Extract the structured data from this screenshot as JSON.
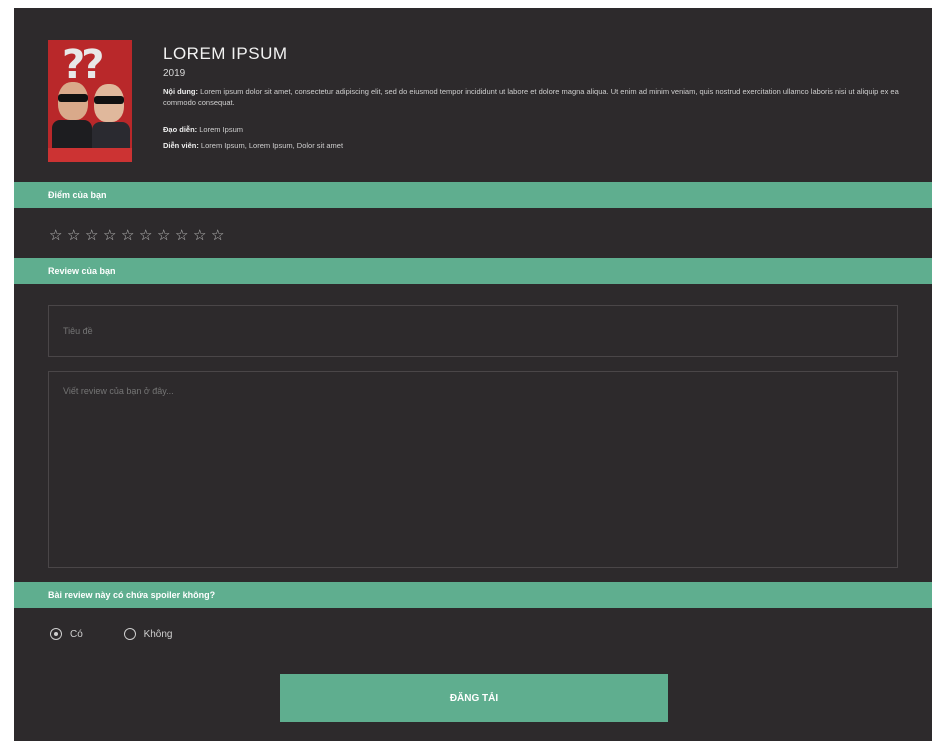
{
  "movie": {
    "title": "LOREM IPSUM",
    "year": "2019",
    "content_label": "Nội dung:",
    "content_text": " Lorem ipsum dolor sit amet, consectetur adipiscing elit, sed do eiusmod tempor incididunt ut labore et dolore magna aliqua. Ut enim ad minim veniam, quis nostrud exercitation ullamco laboris nisi ut aliquip ex ea commodo consequat.",
    "director_label": "Đạo diễn:",
    "director_value": " Lorem Ipsum",
    "cast_label": "Diễn viên:",
    "cast_value": " Lorem Ipsum, Lorem Ipsum, Dolor sit amet",
    "poster_text": "??"
  },
  "score_section": {
    "label": "Điểm của bạn",
    "stars": [
      "☆",
      "☆",
      "☆",
      "☆",
      "☆",
      "☆",
      "☆",
      "☆",
      "☆",
      "☆"
    ],
    "star_count": 10,
    "selected": 0
  },
  "review_section": {
    "label": "Review của bạn",
    "title_placeholder": "Tiêu đề",
    "body_placeholder": "Viết review của bạn ở đây..."
  },
  "spoiler_section": {
    "label": "Bài review này có chứa spoiler không?",
    "options": [
      "Có",
      "Không"
    ],
    "selected": "Có"
  },
  "submit_label": "ĐĂNG TẢI",
  "colors": {
    "background": "#2d2a2c",
    "accent": "#5fae8f"
  }
}
